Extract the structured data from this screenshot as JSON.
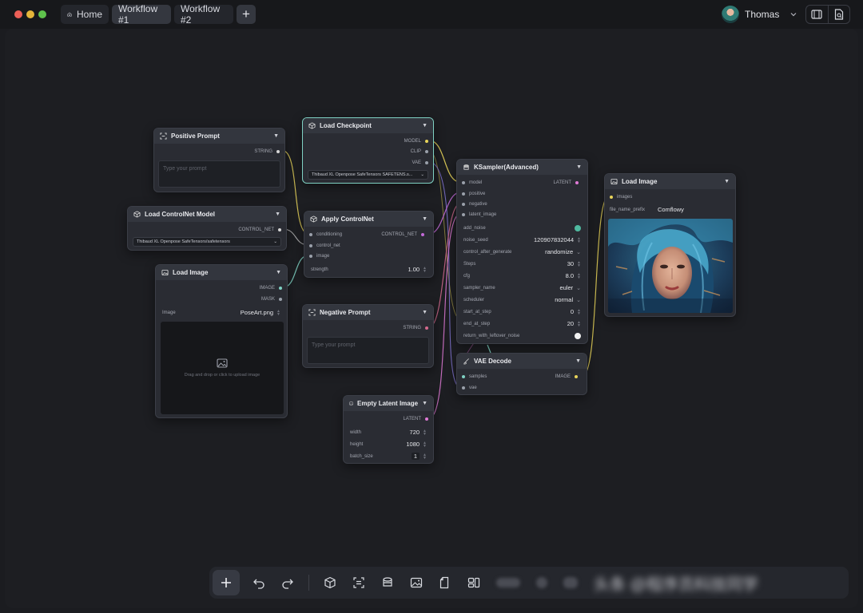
{
  "tabs": [
    {
      "label": "Home",
      "icon": "home-icon"
    },
    {
      "label": "Workflow #1",
      "active": true
    },
    {
      "label": "Workflow #2"
    }
  ],
  "add_tab_label": "+",
  "user": {
    "name": "Thomas"
  },
  "nodes": {
    "positive_prompt": {
      "title": "Positive Prompt",
      "output": "STRING",
      "placeholder": "Type your prompt"
    },
    "load_controlnet": {
      "title": "Load ControlNet Model",
      "output": "CONTROL_NET",
      "model": "Thibaud XL Openpose SafeTensors/safetensors"
    },
    "load_image_left": {
      "title": "Load Image",
      "outputs": [
        "IMAGE",
        "MASK"
      ],
      "field_label": "Image",
      "field_value": "PoseArt.png",
      "upload_text": "Drag and drop or click to upload image"
    },
    "load_checkpoint": {
      "title": "Load Checkpoint",
      "outputs": [
        "MODEL",
        "CLIP",
        "VAE"
      ],
      "model": "Thibaud XL Openpose SafeTensors SAFETENS.s..."
    },
    "apply_controlnet": {
      "title": "Apply ControlNet",
      "inputs": [
        "conditioning",
        "control_net",
        "image"
      ],
      "output": "CONTROL_NET",
      "strength_label": "strength",
      "strength": "1.00"
    },
    "negative_prompt": {
      "title": "Negative Prompt",
      "output": "STRING",
      "placeholder": "Type your prompt"
    },
    "empty_latent": {
      "title": "Empty Latent Image",
      "output": "LATENT",
      "fields": [
        {
          "label": "width",
          "value": "720"
        },
        {
          "label": "height",
          "value": "1080"
        },
        {
          "label": "batch_size",
          "value": "1"
        }
      ]
    },
    "ksampler": {
      "title": "KSampler(Advanced)",
      "inputs": [
        "model",
        "positive",
        "negative",
        "latent_image"
      ],
      "output": "LATENT",
      "fields": [
        {
          "label": "add_noise",
          "value": "",
          "kind": "toggle-on"
        },
        {
          "label": "noise_seed",
          "value": "120907832044",
          "kind": "spin"
        },
        {
          "label": "control_after_generate",
          "value": "randomize",
          "kind": "dropdown"
        },
        {
          "label": "Steps",
          "value": "30",
          "kind": "spin"
        },
        {
          "label": "cfg",
          "value": "8.0",
          "kind": "spin"
        },
        {
          "label": "sampler_name",
          "value": "euler",
          "kind": "dropdown"
        },
        {
          "label": "scheduler",
          "value": "normal",
          "kind": "dropdown"
        },
        {
          "label": "start_at_step",
          "value": "0",
          "kind": "spin"
        },
        {
          "label": "end_at_step",
          "value": "20",
          "kind": "spin"
        },
        {
          "label": "return_with_leftover_noise",
          "value": "",
          "kind": "toggle-off"
        }
      ]
    },
    "vae_decode": {
      "title": "VAE Decode",
      "inputs": [
        "samples",
        "vae"
      ],
      "output": "IMAGE"
    },
    "load_image_right": {
      "title": "Load Image",
      "input": "images",
      "field_label": "file_name_prefix",
      "field_value": "Comflowy"
    }
  },
  "toolbar": {
    "items": [
      "add-node",
      "undo",
      "redo",
      "cube",
      "scan",
      "stack",
      "image",
      "file",
      "layout"
    ],
    "watermark": "头条 @程序员科技同学"
  },
  "colors": {
    "accent": "#7fd1c3",
    "toggle_on": "#4fb9a0",
    "model_wire": "#e8d45a",
    "clip_wire": "#e8d45a",
    "vae_wire": "#d46a8e",
    "image_wire": "#7fd1c3",
    "latent_wire": "#e07ad6",
    "cond_wire": "#c36ad9"
  }
}
